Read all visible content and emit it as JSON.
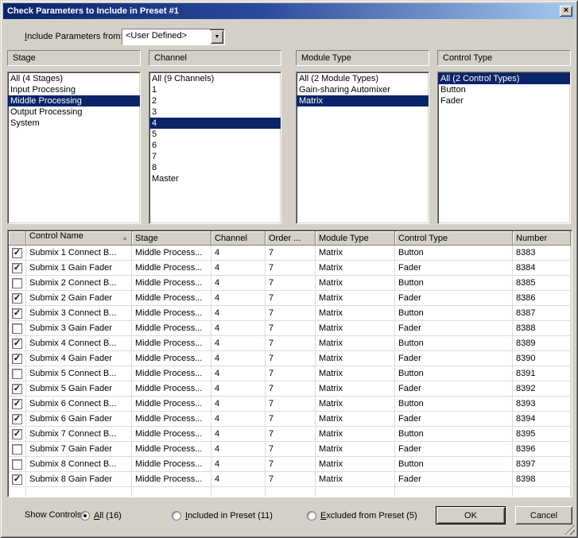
{
  "window": {
    "title": "Check Parameters to Include in Preset #1"
  },
  "icons": {
    "close": "×",
    "dropdown": "▼",
    "sort_asc": "▲",
    "check": "✓"
  },
  "include_from": {
    "label": "Include Parameters from:",
    "mnemonic_index": 0,
    "value": "<User Defined>"
  },
  "filters": [
    {
      "label": "Stage",
      "selected_index": 2,
      "items": [
        "All (4 Stages)",
        "Input Processing",
        "Middle Processing",
        "Output Processing",
        "System"
      ]
    },
    {
      "label": "Channel",
      "selected_index": 4,
      "items": [
        "All (9 Channels)",
        "1",
        "2",
        "3",
        "4",
        "5",
        "6",
        "7",
        "8",
        "Master"
      ]
    },
    {
      "label": "Module Type",
      "selected_index": 2,
      "items": [
        "All (2 Module Types)",
        "Gain-sharing Automixer",
        "Matrix"
      ]
    },
    {
      "label": "Control Type",
      "selected_index": 0,
      "items": [
        "All (2 Control Types)",
        "Button",
        "Fader"
      ]
    }
  ],
  "table": {
    "columns": [
      "",
      "Control Name",
      "Stage",
      "Channel",
      "Order ...",
      "Module Type",
      "Control Type",
      "Number"
    ],
    "sorted_by": "Control Name",
    "sort_direction": "ascending",
    "rows": [
      {
        "checked": true,
        "cells": [
          "Submix 1 Connect B...",
          "Middle Process...",
          "4",
          "7",
          "Matrix",
          "Button",
          "8383"
        ]
      },
      {
        "checked": true,
        "cells": [
          "Submix 1 Gain Fader",
          "Middle Process...",
          "4",
          "7",
          "Matrix",
          "Fader",
          "8384"
        ]
      },
      {
        "checked": false,
        "cells": [
          "Submix 2 Connect B...",
          "Middle Process...",
          "4",
          "7",
          "Matrix",
          "Button",
          "8385"
        ]
      },
      {
        "checked": true,
        "cells": [
          "Submix 2 Gain Fader",
          "Middle Process...",
          "4",
          "7",
          "Matrix",
          "Fader",
          "8386"
        ]
      },
      {
        "checked": true,
        "cells": [
          "Submix 3 Connect B...",
          "Middle Process...",
          "4",
          "7",
          "Matrix",
          "Button",
          "8387"
        ]
      },
      {
        "checked": false,
        "cells": [
          "Submix 3 Gain Fader",
          "Middle Process...",
          "4",
          "7",
          "Matrix",
          "Fader",
          "8388"
        ]
      },
      {
        "checked": true,
        "cells": [
          "Submix 4 Connect B...",
          "Middle Process...",
          "4",
          "7",
          "Matrix",
          "Button",
          "8389"
        ]
      },
      {
        "checked": true,
        "cells": [
          "Submix 4 Gain Fader",
          "Middle Process...",
          "4",
          "7",
          "Matrix",
          "Fader",
          "8390"
        ]
      },
      {
        "checked": false,
        "cells": [
          "Submix 5 Connect B...",
          "Middle Process...",
          "4",
          "7",
          "Matrix",
          "Button",
          "8391"
        ]
      },
      {
        "checked": true,
        "cells": [
          "Submix 5 Gain Fader",
          "Middle Process...",
          "4",
          "7",
          "Matrix",
          "Fader",
          "8392"
        ]
      },
      {
        "checked": true,
        "cells": [
          "Submix 6 Connect B...",
          "Middle Process...",
          "4",
          "7",
          "Matrix",
          "Button",
          "8393"
        ]
      },
      {
        "checked": true,
        "cells": [
          "Submix 6 Gain Fader",
          "Middle Process...",
          "4",
          "7",
          "Matrix",
          "Fader",
          "8394"
        ]
      },
      {
        "checked": true,
        "cells": [
          "Submix 7 Connect B...",
          "Middle Process...",
          "4",
          "7",
          "Matrix",
          "Button",
          "8395"
        ]
      },
      {
        "checked": false,
        "cells": [
          "Submix 7 Gain Fader",
          "Middle Process...",
          "4",
          "7",
          "Matrix",
          "Fader",
          "8396"
        ]
      },
      {
        "checked": false,
        "cells": [
          "Submix 8 Connect B...",
          "Middle Process...",
          "4",
          "7",
          "Matrix",
          "Button",
          "8397"
        ]
      },
      {
        "checked": true,
        "cells": [
          "Submix 8 Gain Fader",
          "Middle Process...",
          "4",
          "7",
          "Matrix",
          "Fader",
          "8398"
        ]
      }
    ]
  },
  "footer": {
    "show_controls_label": "Show Controls:",
    "radios": [
      {
        "label": "All (16)",
        "mnemonic_index": 0,
        "selected": true
      },
      {
        "label": "Included in Preset (11)",
        "mnemonic_index": 0,
        "selected": false
      },
      {
        "label": "Excluded from Preset (5)",
        "mnemonic_index": 0,
        "selected": false
      }
    ],
    "ok_label": "OK",
    "cancel_label": "Cancel"
  }
}
